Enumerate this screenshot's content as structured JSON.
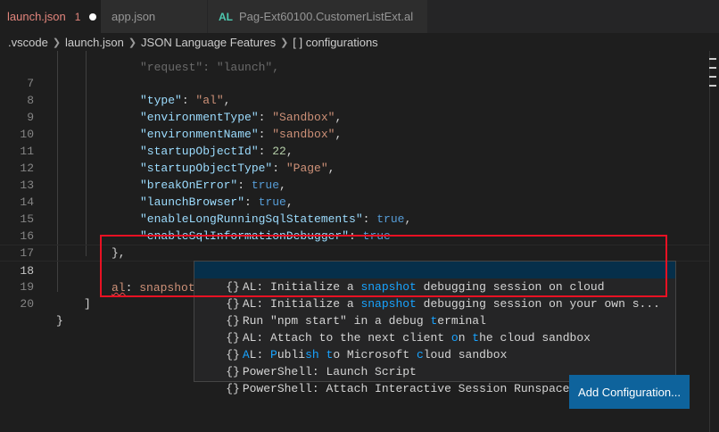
{
  "tabs": [
    {
      "name": "launch.json",
      "badge": "1",
      "modified": true
    },
    {
      "name": "app.json"
    },
    {
      "name": "Pag-Ext60100.CustomerListExt.al",
      "icon_text": "AL"
    }
  ],
  "breadcrumb": [
    ".vscode",
    "launch.json",
    "JSON Language Features",
    "[ ] configurations"
  ],
  "code": {
    "line_numbers": [
      "7",
      "8",
      "9",
      "10",
      "11",
      "12",
      "13",
      "14",
      "15",
      "16",
      "17",
      "18",
      "19",
      "20"
    ],
    "partial_top": "\"request\": \"launch\",",
    "l7": {
      "key": "\"type\"",
      "val": "\"al\""
    },
    "l8": {
      "key": "\"environmentType\"",
      "val": "\"Sandbox\""
    },
    "l9": {
      "key": "\"environmentName\"",
      "val": "\"sandbox\""
    },
    "l10": {
      "key": "\"startupObjectId\"",
      "val": "22"
    },
    "l11": {
      "key": "\"startupObjectType\"",
      "val": "\"Page\""
    },
    "l12": {
      "key": "\"breakOnError\"",
      "val": "true"
    },
    "l13": {
      "key": "\"launchBrowser\"",
      "val": "true"
    },
    "l14": {
      "key": "\"enableLongRunningSqlStatements\"",
      "val": "true"
    },
    "l15": {
      "key": "\"enableSqlInformationDebugger\"",
      "val": "true"
    },
    "l16": "},",
    "l18": {
      "prefix": "al",
      "colon": ": ",
      "typed": "snapshot"
    },
    "l20": "}"
  },
  "suggestions": [
    {
      "icon": "{}",
      "parts": [
        "AL: Initialize a ",
        "snapshot",
        " debugging session on cloud"
      ],
      "selected": true
    },
    {
      "icon": "{}",
      "parts": [
        "AL: Initialize a ",
        "snapshot",
        " debugging session on your own s..."
      ]
    },
    {
      "icon": "{}",
      "parts": [
        "Run \"npm start\" in a debug ",
        "t",
        "erminal"
      ]
    },
    {
      "icon": "{}",
      "parts": [
        "AL: Attach to the next client ",
        "o",
        "n ",
        "t",
        "he cloud sandbox"
      ]
    },
    {
      "icon": "{}",
      "parts": [
        "",
        "A",
        "L: ",
        "P",
        "ubli",
        "sh",
        " ",
        "t",
        "o Microsoft ",
        "c",
        "loud sandbox"
      ]
    },
    {
      "icon": "{}",
      "parts": [
        "PowerShell: Launch Script"
      ]
    },
    {
      "icon": "{}",
      "parts": [
        "PowerShell: Attach Interactive Session Runspace"
      ]
    }
  ],
  "add_config_label": "Add Configuration...",
  "colors": {
    "accent": "#0e639c",
    "selection": "#062f4a",
    "match": "#18a3ff",
    "error_box": "#e81123"
  }
}
